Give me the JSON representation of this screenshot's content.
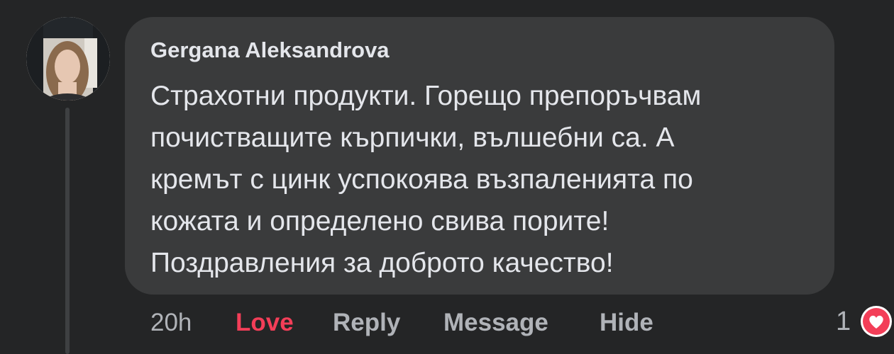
{
  "comment": {
    "author": "Gergana Aleksandrova",
    "text_lines": [
      "Страхотни продукти. Горещо препоръчвам",
      "почистващите кърпички, вълшебни са. А",
      "кремът с цинк успокоява възпаленията по",
      "кожата и определено свива порите!",
      "Поздравления за доброто качество!"
    ]
  },
  "actions": {
    "time": "20h",
    "love_label": "Love",
    "reply_label": "Reply",
    "message_label": "Message",
    "hide_label": "Hide"
  },
  "reactions": {
    "count": "1",
    "icon": "love-heart-icon"
  },
  "colors": {
    "background": "#242526",
    "bubble": "#3a3b3c",
    "text": "#e4e6eb",
    "secondary_text": "#b0b3b8",
    "love": "#f33e58"
  }
}
